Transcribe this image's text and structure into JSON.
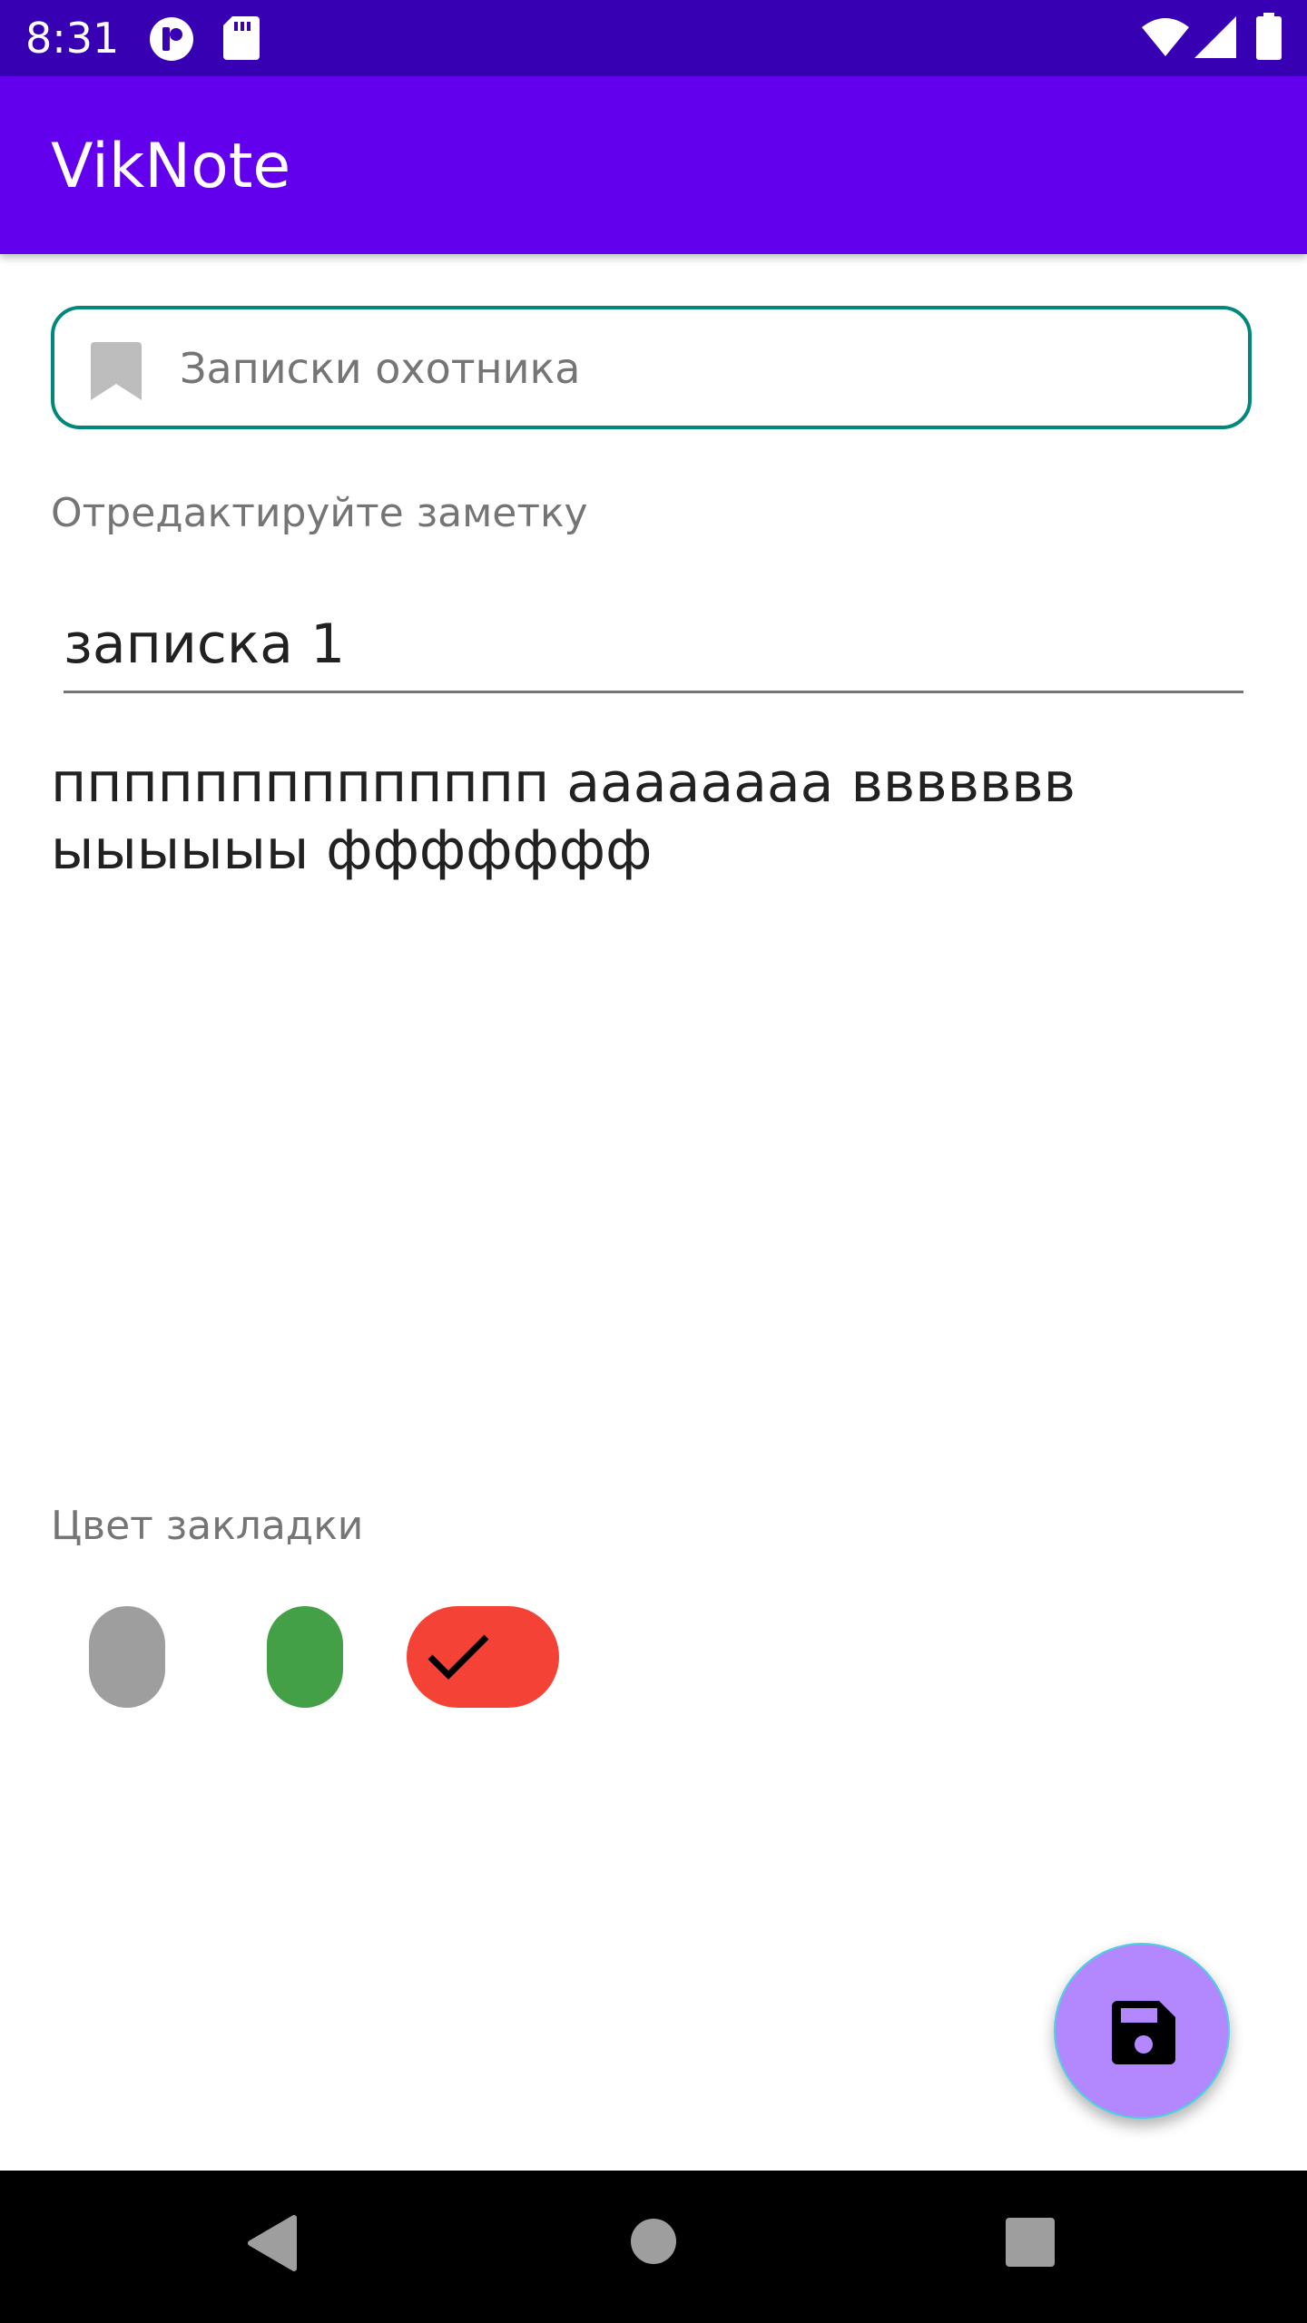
{
  "status_bar": {
    "time": "8:31",
    "icons": [
      "notification-app-icon",
      "sd-card-icon",
      "wifi-icon",
      "signal-icon",
      "battery-icon"
    ]
  },
  "app_bar": {
    "title": "VikNote"
  },
  "category_field": {
    "icon": "bookmark-icon",
    "value": "Записки охотника"
  },
  "editor": {
    "hint_label": "Отредактируйте заметку",
    "title_value": "записка 1",
    "body_value": "пппппппппппппп ааааааaa ввввввв\nыыыыыы ффффффф"
  },
  "bookmark_color": {
    "label": "Цвет закладки",
    "options": [
      {
        "name": "gray",
        "color": "#9e9e9e",
        "selected": false
      },
      {
        "name": "green",
        "color": "#43a047",
        "selected": false
      },
      {
        "name": "red",
        "color": "#f44336",
        "selected": true
      }
    ]
  },
  "fab": {
    "icon": "save-icon",
    "color": "#b388ff"
  },
  "colors": {
    "status_bar": "#3700b3",
    "app_bar": "#6200ee",
    "field_border": "#00897b"
  },
  "nav_bar": {
    "buttons": [
      "back-icon",
      "home-icon",
      "recents-icon"
    ]
  }
}
